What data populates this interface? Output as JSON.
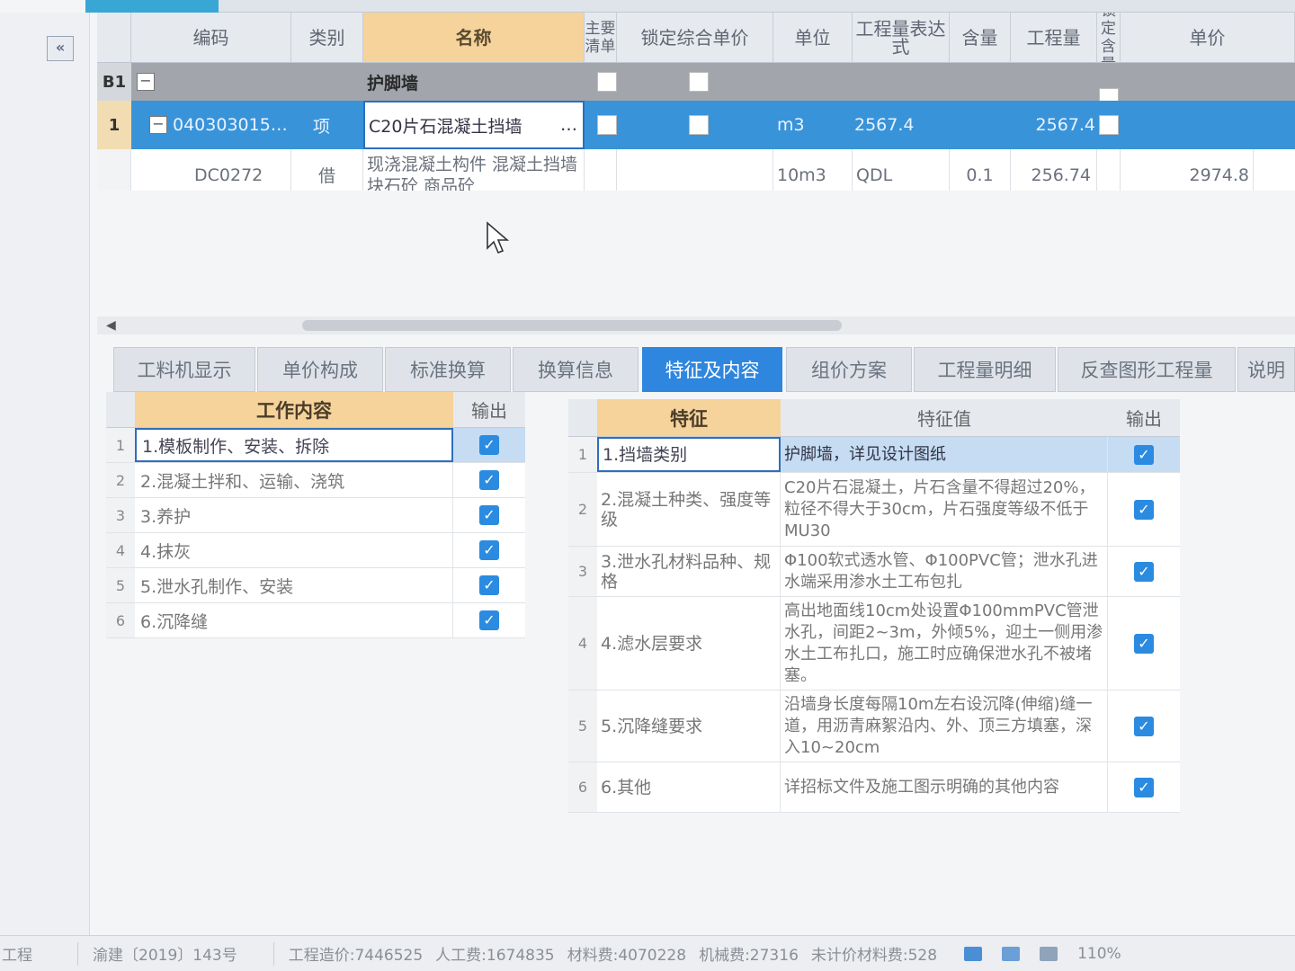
{
  "upper": {
    "columns": [
      "编码",
      "类别",
      "名称",
      "主要清单",
      "锁定综合单价",
      "单位",
      "工程量表达式",
      "含量",
      "工程量",
      "锁定含量",
      "单价"
    ],
    "row_b1": {
      "num": "B1",
      "name": "护脚墙"
    },
    "row_1": {
      "num": "1",
      "code": "040303015…",
      "type": "项",
      "name": "C20片石混凝土挡墙",
      "ellipsis": "…",
      "unit": "m3",
      "expr": "2567.4",
      "qty": "2567.4"
    },
    "row_2": {
      "code": "DC0272",
      "type": "借",
      "name": "现浇混凝土构件 混凝土挡墙 块石砼 商品砼",
      "unit": "10m3",
      "expr": "QDL",
      "content": "0.1",
      "qty": "256.74",
      "price": "2974.8"
    }
  },
  "tabs": [
    "工料机显示",
    "单价构成",
    "标准换算",
    "换算信息",
    "特征及内容",
    "组价方案",
    "工程量明细",
    "反查图形工程量",
    "说明"
  ],
  "active_tab": "特征及内容",
  "work_content": {
    "header": "工作内容",
    "output_header": "输出",
    "rows": [
      {
        "num": "1",
        "text": "1.模板制作、安装、拆除"
      },
      {
        "num": "2",
        "text": "2.混凝土拌和、运输、浇筑"
      },
      {
        "num": "3",
        "text": "3.养护"
      },
      {
        "num": "4",
        "text": "4.抹灰"
      },
      {
        "num": "5",
        "text": "5.泄水孔制作、安装"
      },
      {
        "num": "6",
        "text": "6.沉降缝"
      }
    ]
  },
  "features": {
    "header": "特征",
    "value_header": "特征值",
    "output_header": "输出",
    "rows": [
      {
        "num": "1",
        "name": "1.挡墙类别",
        "value": "护脚墙，详见设计图纸"
      },
      {
        "num": "2",
        "name": "2.混凝土种类、强度等级",
        "value": "C20片石混凝土，片石含量不得超过20%，粒径不得大于30cm，片石强度等级不低于MU30"
      },
      {
        "num": "3",
        "name": "3.泄水孔材料品种、规格",
        "value": "Φ100软式透水管、Φ100PVC管；泄水孔进水端采用渗水土工布包扎"
      },
      {
        "num": "4",
        "name": "4.滤水层要求",
        "value": "高出地面线10cm处设置Φ100mmPVC管泄水孔，间距2~3m，外倾5%，迎土一侧用渗水土工布扎口，施工时应确保泄水孔不被堵塞。"
      },
      {
        "num": "5",
        "name": "5.沉降缝要求",
        "value": "沿墙身长度每隔10m左右设沉降(伸缩)缝一道，用沥青麻絮沿内、外、顶三方填塞，深入10~20cm"
      },
      {
        "num": "6",
        "name": "6.其他",
        "value": "详招标文件及施工图示明确的其他内容"
      }
    ]
  },
  "statusbar": {
    "project": "工程",
    "standard": "渝建〔2019〕143号",
    "total": "工程造价:7446525",
    "labor": "人工费:1674835",
    "material": "材料费:4070228",
    "machine": "机械费:27316",
    "unpriced": "未计价材料费:528",
    "zoom": "110%"
  },
  "colors": {
    "accent": "#2f86de",
    "header_highlight": "#f5d39b",
    "selected_row": "#3993d8"
  },
  "icons": [
    "collapse-left-icon",
    "minus-box-icon",
    "checkbox-checked-icon",
    "mouse-cursor-icon"
  ]
}
